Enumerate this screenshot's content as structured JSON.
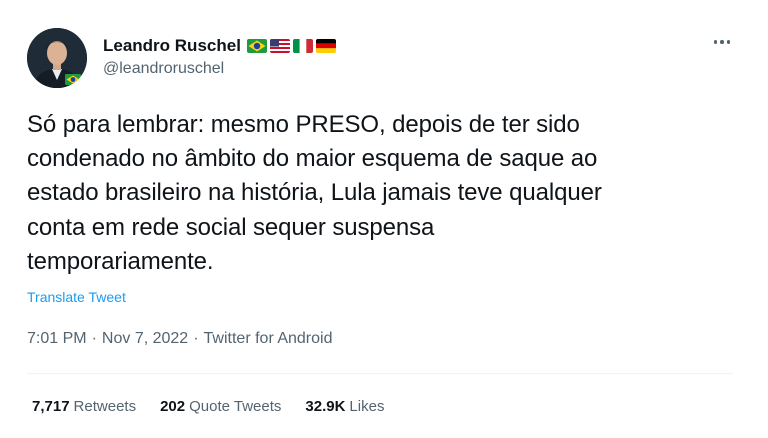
{
  "author": {
    "display_name": "Leandro Ruschel",
    "handle": "@leandroruschel",
    "flags": [
      "brazil-flag",
      "usa-flag",
      "italy-flag",
      "germany-flag"
    ]
  },
  "tweet": {
    "text": "Só para lembrar: mesmo PRESO, depois de ter sido\ncondenado no âmbito do maior esquema de saque ao\nestado brasileiro na história, Lula jamais teve qualquer\nconta em rede social sequer suspensa\ntemporariamente.",
    "translate_label": "Translate Tweet",
    "time": "7:01 PM",
    "date": "Nov 7, 2022",
    "source": "Twitter for Android",
    "separator": "·"
  },
  "stats": {
    "retweets_count": "7,717",
    "retweets_label": "Retweets",
    "quote_tweets_count": "202",
    "quote_tweets_label": "Quote Tweets",
    "likes_count": "32.9K",
    "likes_label": "Likes"
  },
  "colors": {
    "text_primary": "#0f1419",
    "text_secondary": "#536471",
    "link": "#1d9bf0",
    "divider": "#eff3f4"
  },
  "icons": {
    "more": "more-options-icon"
  }
}
